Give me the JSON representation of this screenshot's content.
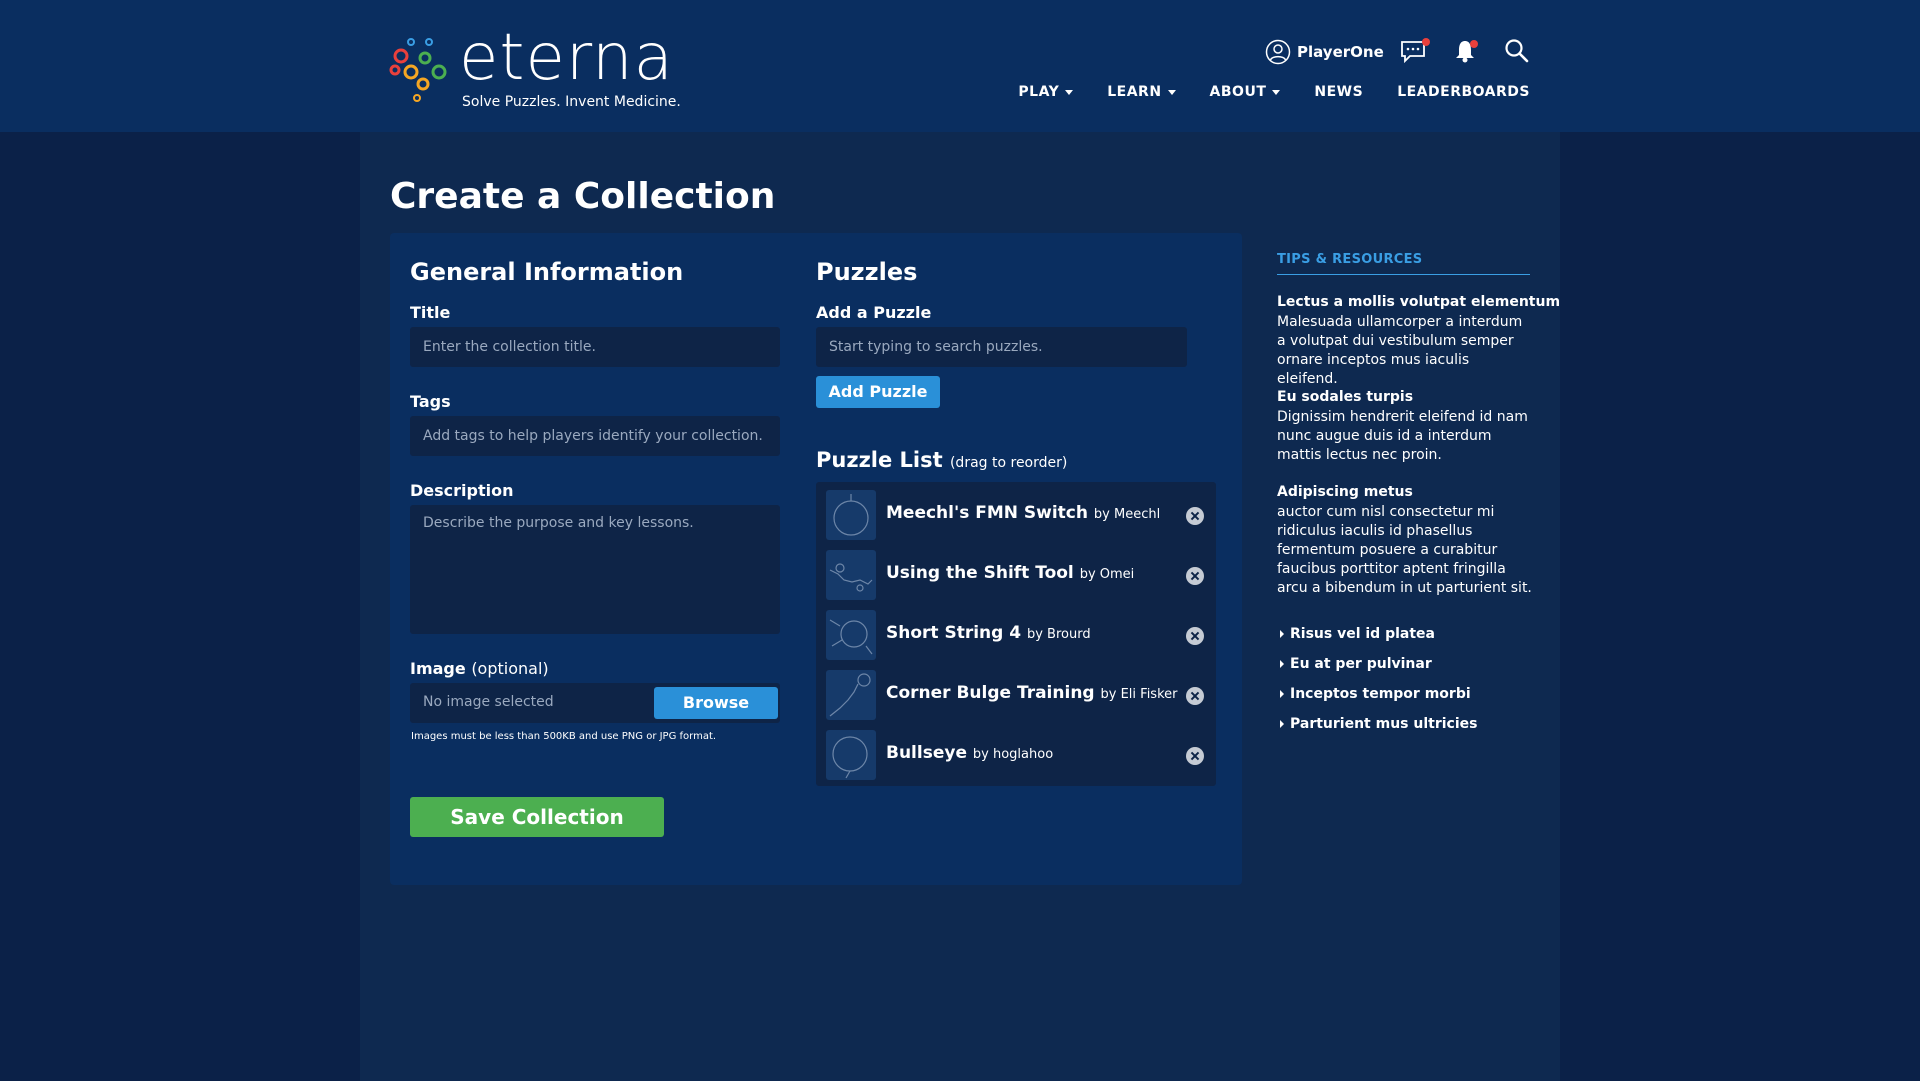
{
  "header": {
    "logo_word": "eterna",
    "logo_tagline": "Solve Puzzles. Invent Medicine.",
    "username": "PlayerOne",
    "icons": [
      "user-icon",
      "chat-icon",
      "bell-icon",
      "search-icon"
    ],
    "nav": [
      {
        "label": "PLAY",
        "dropdown": true
      },
      {
        "label": "LEARN",
        "dropdown": true
      },
      {
        "label": "ABOUT",
        "dropdown": true
      },
      {
        "label": "NEWS",
        "dropdown": false
      },
      {
        "label": "LEADERBOARDS",
        "dropdown": false
      }
    ]
  },
  "page": {
    "title": "Create a Collection"
  },
  "general": {
    "heading": "General Information",
    "title_label": "Title",
    "title_placeholder": "Enter the collection title.",
    "tags_label": "Tags",
    "tags_placeholder": "Add tags to help players identify your collection.",
    "description_label": "Description",
    "description_placeholder": "Describe the purpose and key lessons.",
    "image_label": "Image",
    "image_label_suffix": "(optional)",
    "image_value": "No image selected",
    "browse_label": "Browse",
    "image_hint": "Images must be less than 500KB and use PNG or JPG format.",
    "save_label": "Save Collection"
  },
  "puzzles": {
    "heading": "Puzzles",
    "add_label": "Add a Puzzle",
    "search_placeholder": "Start typing to search puzzles.",
    "add_button": "Add Puzzle",
    "list_heading": "Puzzle List",
    "list_hint": "(drag to reorder)",
    "items": [
      {
        "title": "Meechl's FMN Switch",
        "by": "by Meechl"
      },
      {
        "title": "Using the Shift Tool",
        "by": "by Omei"
      },
      {
        "title": "Short String 4",
        "by": "by Brourd"
      },
      {
        "title": "Corner Bulge Training",
        "by": "by Eli Fisker"
      },
      {
        "title": "Bullseye",
        "by": "by hoglahoo"
      }
    ]
  },
  "sidebar": {
    "heading": "TIPS & RESOURCES",
    "tips": [
      {
        "title": "Lectus a mollis volutpat elementum",
        "body": "Malesuada ullamcorper a interdum a volutpat dui vestibulum semper ornare inceptos mus iaculis eleifend."
      },
      {
        "title": "Eu sodales turpis",
        "body": "Dignissim hendrerit eleifend id nam nunc augue duis id a interdum mattis lectus nec proin."
      },
      {
        "title": "Adipiscing metus",
        "body": "auctor cum nisl consectetur mi ridiculus iaculis id phasellus fermentum posuere a curabitur faucibus porttitor aptent fringilla arcu a bibendum in ut parturient sit."
      }
    ],
    "links": [
      "Risus vel id platea",
      "Eu at per pulvinar",
      "Inceptos tempor morbi",
      "Parturient mus ultricies"
    ]
  },
  "colors": {
    "header_bg": "#0a2e60",
    "page_bg": "#0b2148",
    "accent_blue": "#2a90d8",
    "save_green": "#4caf50",
    "notification_red": "#e9403c"
  }
}
